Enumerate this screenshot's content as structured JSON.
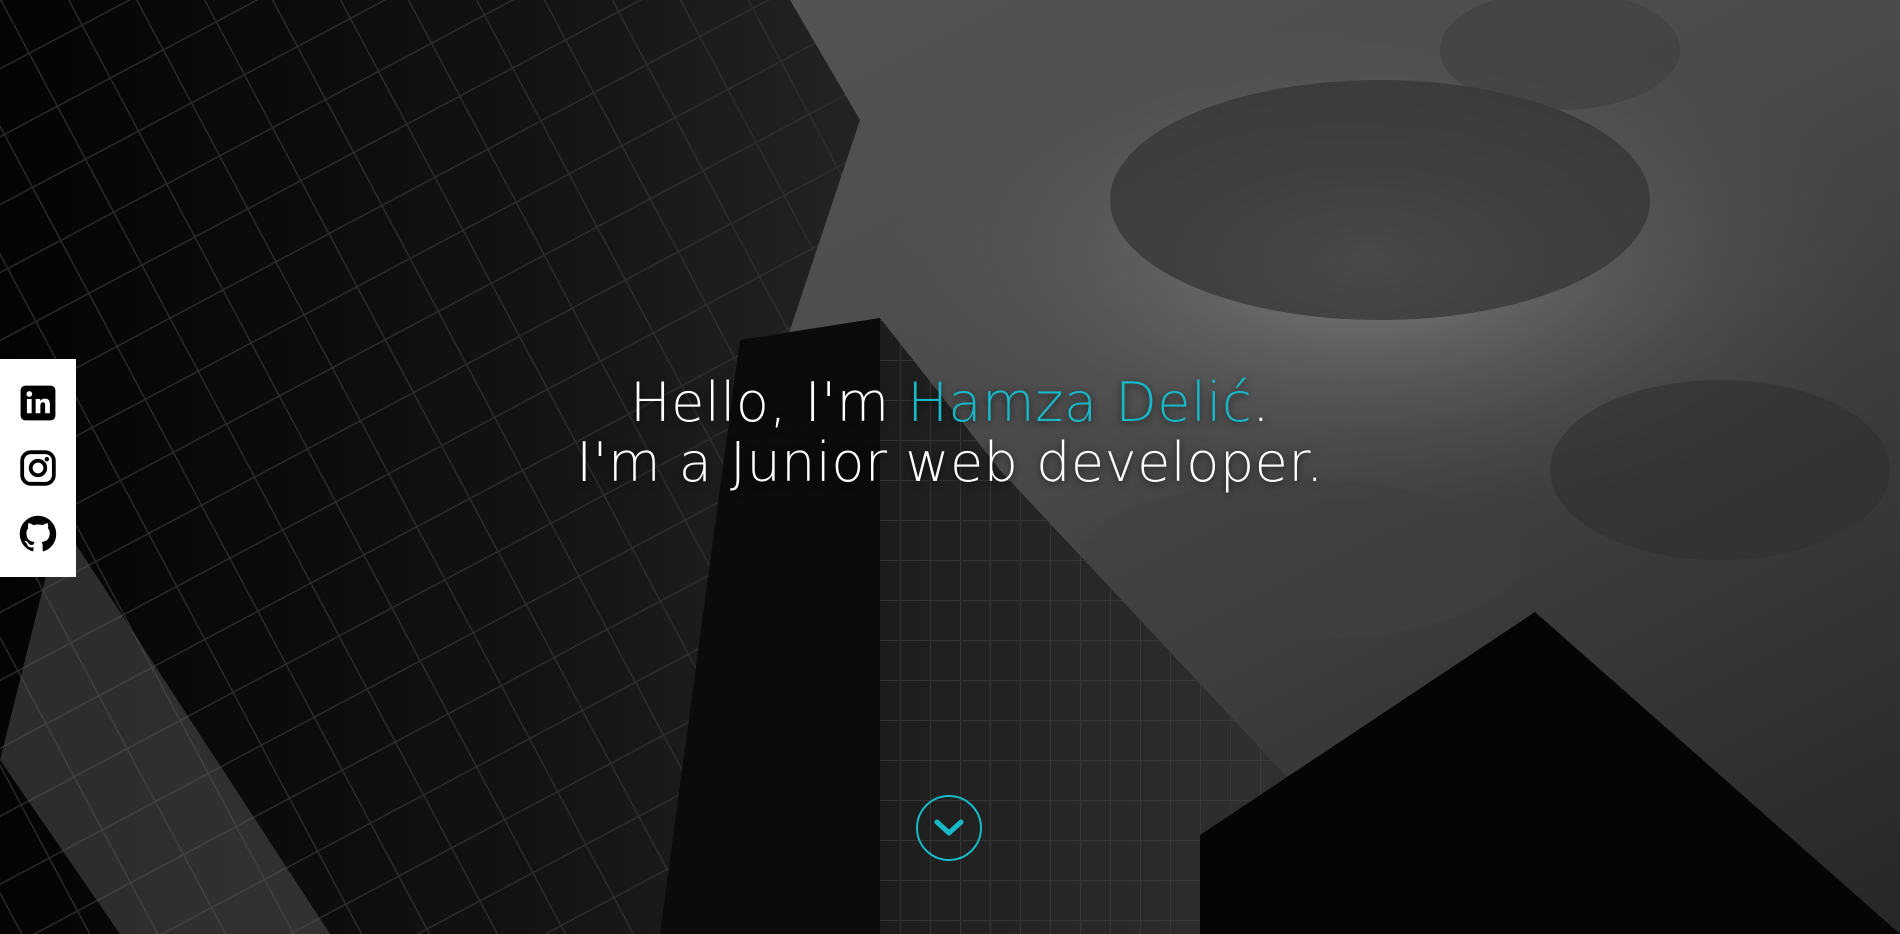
{
  "hero": {
    "greeting_prefix": "Hello, I'm ",
    "name": "Hamza Delić",
    "greeting_suffix": ".",
    "tagline": "I'm a Junior web developer."
  },
  "social": {
    "links": [
      {
        "icon": "linkedin-icon"
      },
      {
        "icon": "instagram-icon"
      },
      {
        "icon": "github-icon"
      }
    ]
  },
  "scroll": {
    "icon": "chevron-down-icon"
  },
  "colors": {
    "accent": "#17b8c7",
    "text": "#ffffff",
    "social_bar": "#ffffff"
  }
}
